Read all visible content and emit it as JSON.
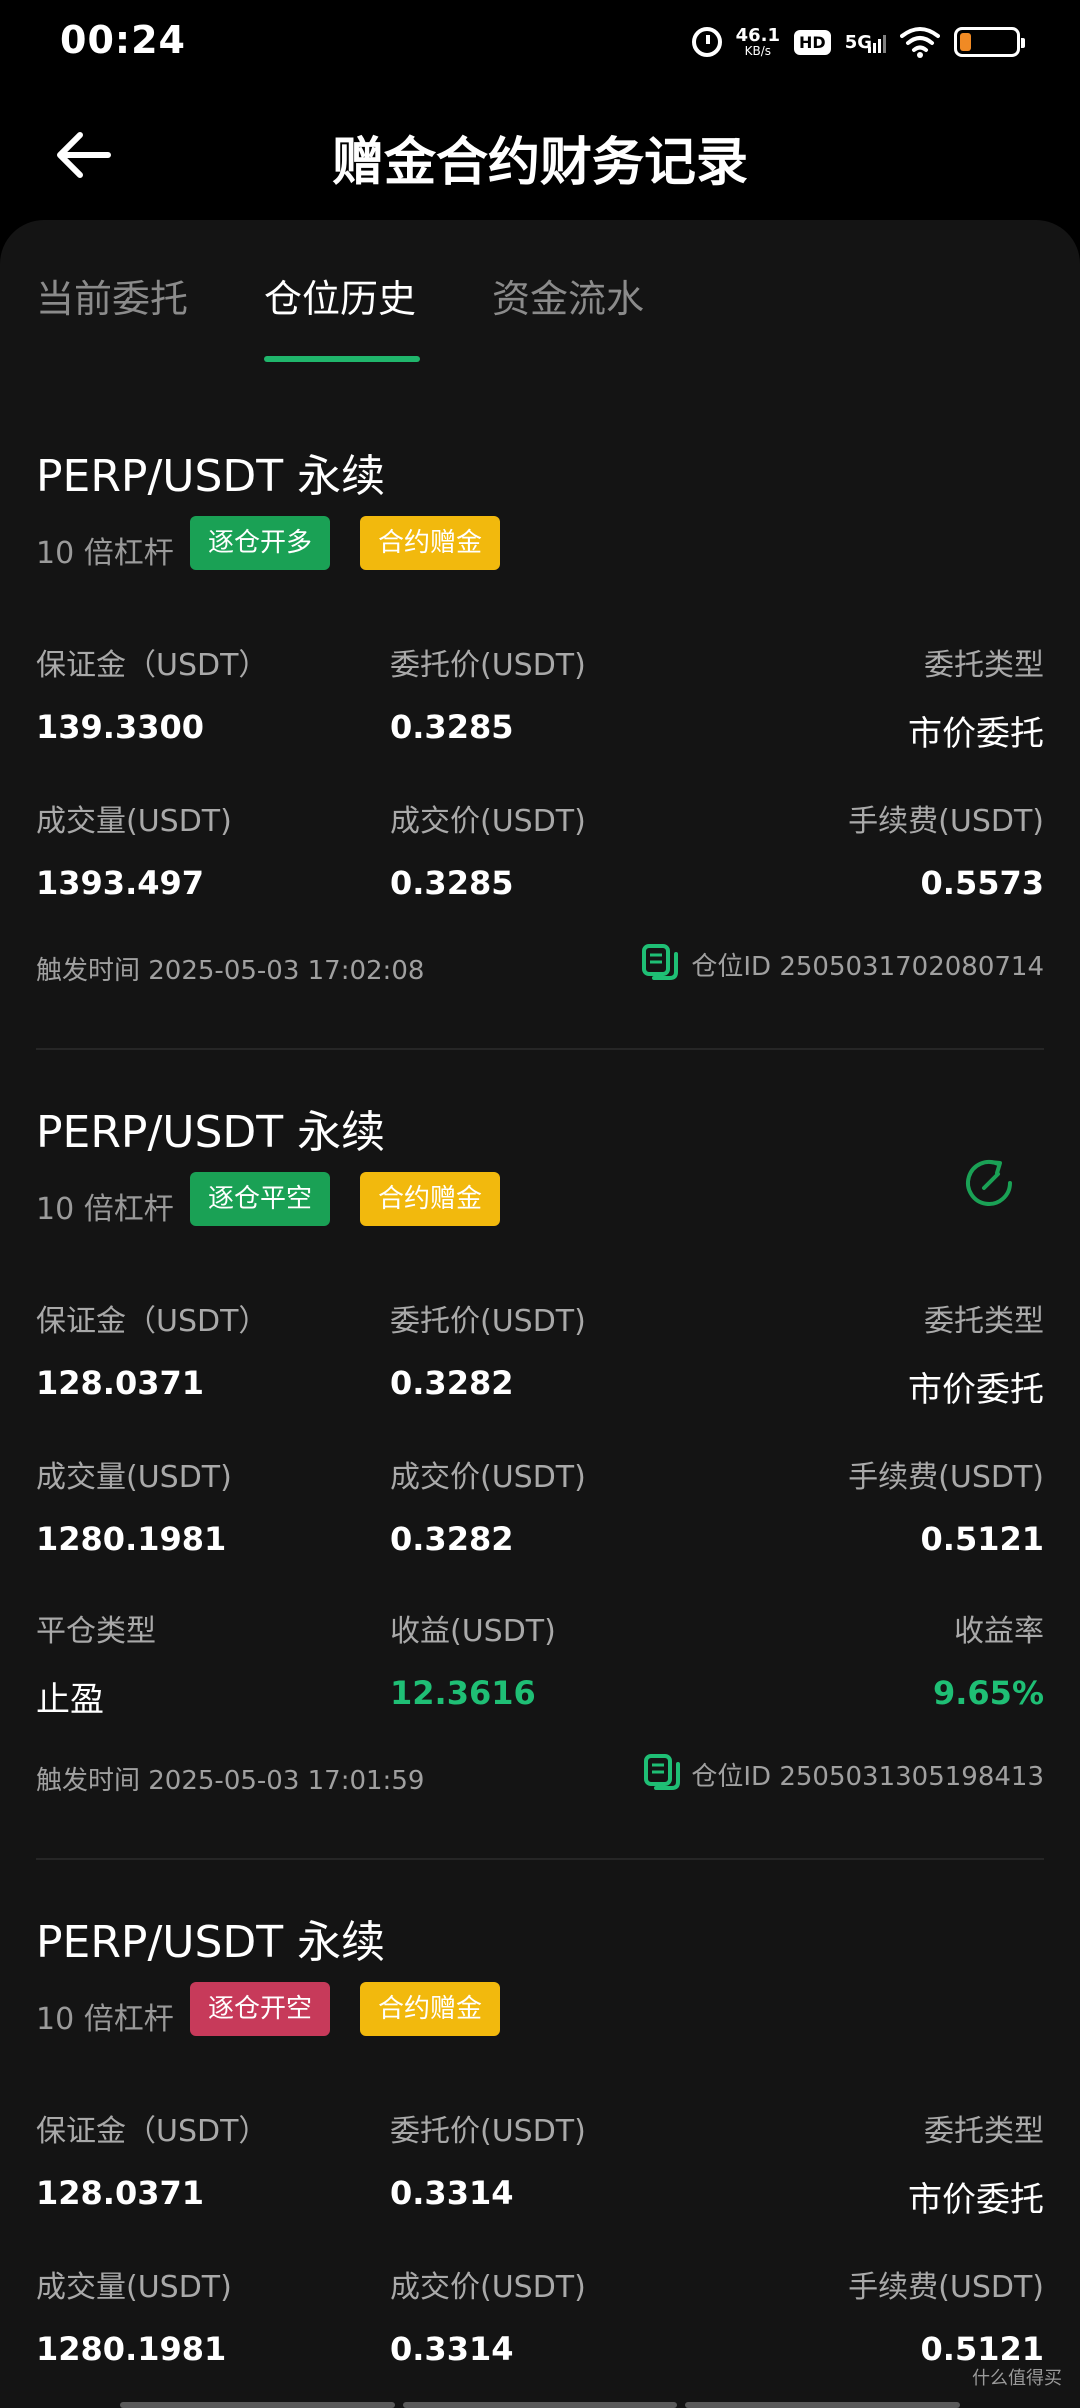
{
  "status_bar": {
    "time": "00:24",
    "net_speed": "46.1",
    "net_unit": "KB/s",
    "hd": "HD",
    "network": "5G",
    "battery_percent": 20
  },
  "header": {
    "title": "赠金合约财务记录"
  },
  "tabs": [
    {
      "label": "当前委托",
      "active": false
    },
    {
      "label": "仓位历史",
      "active": true
    },
    {
      "label": "资金流水",
      "active": false
    }
  ],
  "records": [
    {
      "pair": "PERP/USDT 永续",
      "leverage": "10 倍杠杆",
      "side_tag": "逐仓开多",
      "bonus_tag": "合约赠金",
      "margin_label": "保证金（USDT）",
      "margin": "139.3300",
      "order_price_label": "委托价(USDT)",
      "order_price": "0.3285",
      "order_type_label": "委托类型",
      "order_type": "市价委托",
      "volume_label": "成交量(USDT)",
      "volume": "1393.497",
      "fill_price_label": "成交价(USDT)",
      "fill_price": "0.3285",
      "fee_label": "手续费(USDT)",
      "fee": "0.5573",
      "time": "触发时间 2025-05-03 17:02:08",
      "position_id": "仓位ID 2505031702080714"
    },
    {
      "pair": "PERP/USDT 永续",
      "leverage": "10 倍杠杆",
      "side_tag": "逐仓平空",
      "bonus_tag": "合约赠金",
      "margin_label": "保证金（USDT）",
      "margin": "128.0371",
      "order_price_label": "委托价(USDT)",
      "order_price": "0.3282",
      "order_type_label": "委托类型",
      "order_type": "市价委托",
      "volume_label": "成交量(USDT)",
      "volume": "1280.1981",
      "fill_price_label": "成交价(USDT)",
      "fill_price": "0.3282",
      "fee_label": "手续费(USDT)",
      "fee": "0.5121",
      "close_type_label": "平仓类型",
      "close_type": "止盈",
      "pnl_label": "收益(USDT)",
      "pnl": "12.3616",
      "pnl_rate_label": "收益率",
      "pnl_rate": "9.65%",
      "time": "触发时间 2025-05-03 17:01:59",
      "position_id": "仓位ID 2505031305198413"
    },
    {
      "pair": "PERP/USDT 永续",
      "leverage": "10 倍杠杆",
      "side_tag": "逐仓开空",
      "bonus_tag": "合约赠金",
      "margin_label": "保证金（USDT）",
      "margin": "128.0371",
      "order_price_label": "委托价(USDT)",
      "order_price": "0.3314",
      "order_type_label": "委托类型",
      "order_type": "市价委托",
      "volume_label": "成交量(USDT)",
      "volume": "1280.1981",
      "fill_price_label": "成交价(USDT)",
      "fill_price": "0.3314",
      "fee_label": "手续费(USDT)",
      "fee": "0.5121"
    }
  ],
  "colors": {
    "accent_green": "#20b66c",
    "long_green": "#1aa155",
    "short_red": "#c73a5a",
    "bonus_yellow": "#f2b90d",
    "profit_green": "#1fbf75"
  },
  "watermark": "什么值得买"
}
